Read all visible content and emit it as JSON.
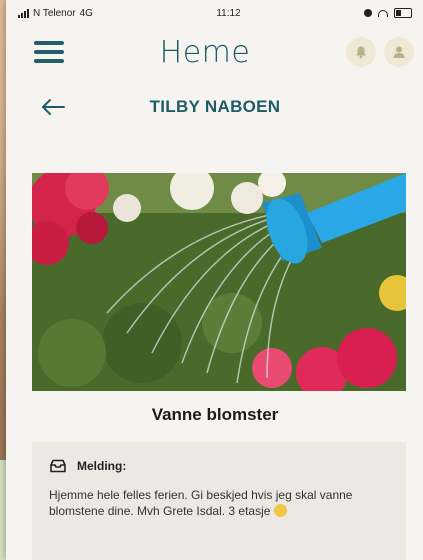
{
  "status_bar": {
    "carrier": "N Telenor",
    "network": "4G",
    "time": "11:12"
  },
  "app": {
    "logo": "Heme"
  },
  "header": {
    "title": "TILBY NABOEN"
  },
  "listing": {
    "title": "Vanne blomster",
    "message_label": "Melding:",
    "message_text": "Hjemme hele felles ferien. Gi beskjed hvis jeg skal vanne blomstene dine. Mvh Grete Isdal. 3 etasje"
  },
  "icons": {
    "menu": "hamburger-menu-icon",
    "notifications": "bell-icon",
    "profile": "person-icon",
    "back": "arrow-left-icon",
    "message": "inbox-icon",
    "emoji": "smiley-emoji-icon"
  },
  "colors": {
    "brand": "#1f5c66",
    "action_circle": "#efe8d4",
    "message_bg": "#ece9e3",
    "page_bg": "#f6f4f1"
  }
}
